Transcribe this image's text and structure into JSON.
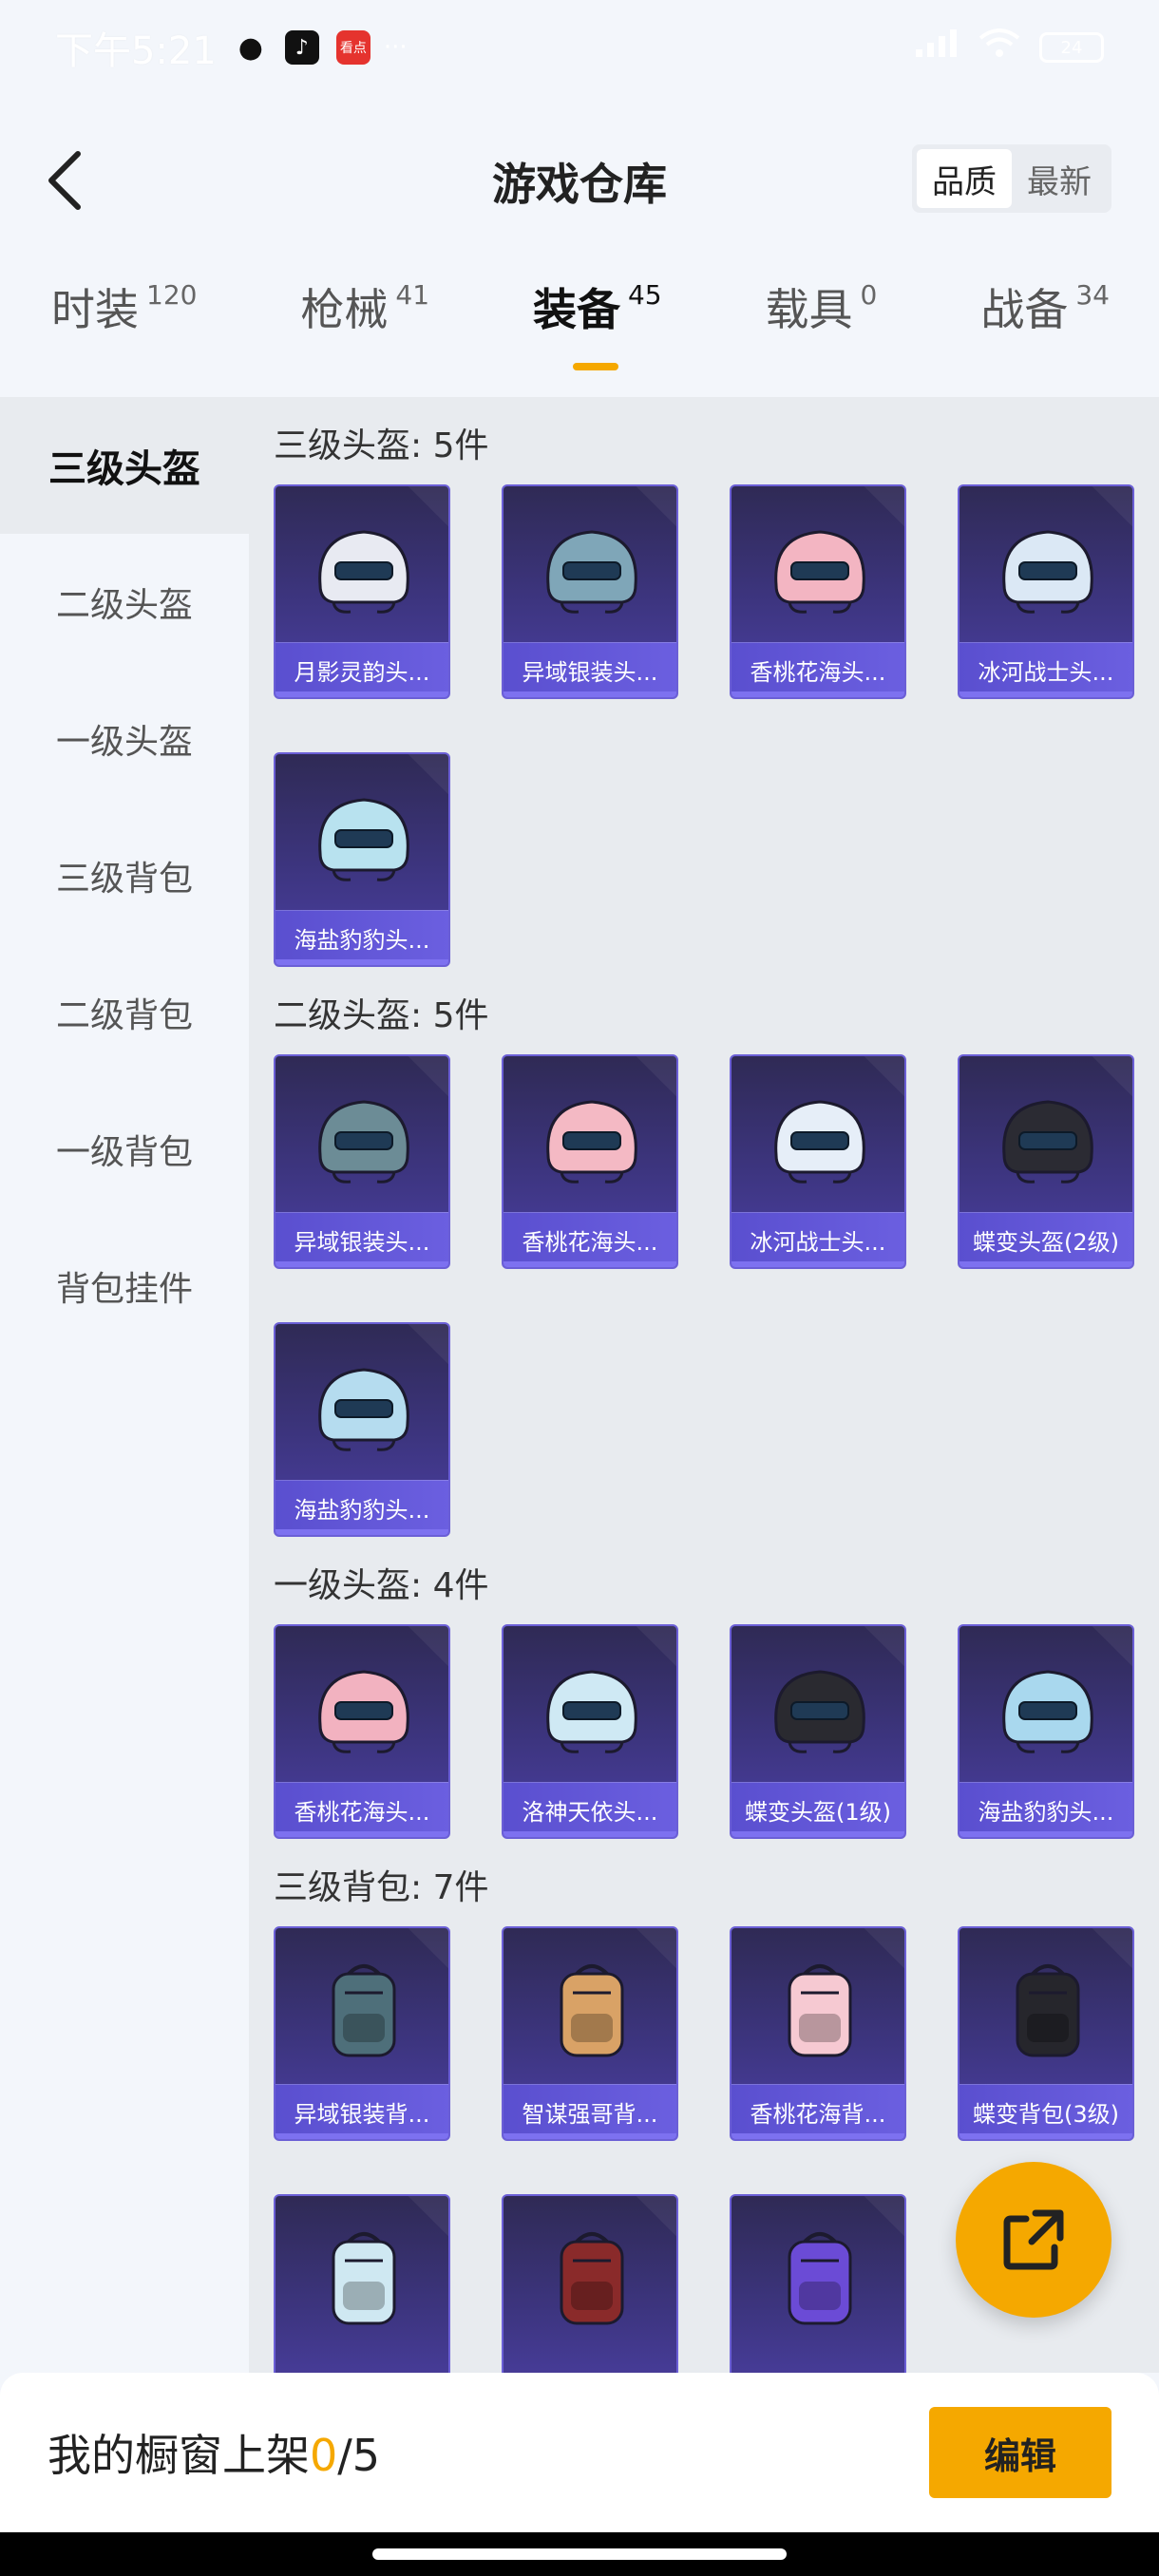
{
  "status_bar": {
    "time": "下午5:21",
    "apps": [
      "qq-icon",
      "tiktok-icon",
      "kandian-icon"
    ],
    "kandian_label": "看点",
    "dots": "···",
    "battery": "24"
  },
  "header": {
    "title": "游戏仓库",
    "sort_options": [
      "品质",
      "最新"
    ],
    "active_sort": "品质"
  },
  "tabs": [
    {
      "label": "时装",
      "count": "120"
    },
    {
      "label": "枪械",
      "count": "41"
    },
    {
      "label": "装备",
      "count": "45"
    },
    {
      "label": "载具",
      "count": "0"
    },
    {
      "label": "战备",
      "count": "34"
    }
  ],
  "active_tab": "装备",
  "sidebar": [
    {
      "label": "三级头盔"
    },
    {
      "label": "二级头盔"
    },
    {
      "label": "一级头盔"
    },
    {
      "label": "三级背包"
    },
    {
      "label": "二级背包"
    },
    {
      "label": "一级背包"
    },
    {
      "label": "背包挂件"
    }
  ],
  "active_sidebar": "三级头盔",
  "sections": [
    {
      "title": "三级头盔: 5件",
      "items": [
        {
          "name": "月影灵韵头...",
          "icon": "helmet-icon",
          "color": "#e8eaf2"
        },
        {
          "name": "异域银装头...",
          "icon": "helmet-icon",
          "color": "#7fa6b8"
        },
        {
          "name": "香桃花海头...",
          "icon": "helmet-icon",
          "color": "#f3b5c2"
        },
        {
          "name": "冰河战士头...",
          "icon": "helmet-icon",
          "color": "#dbe8f5"
        },
        {
          "name": "海盐豹豹头...",
          "icon": "helmet-icon",
          "color": "#b8e2ef"
        }
      ]
    },
    {
      "title": "二级头盔: 5件",
      "items": [
        {
          "name": "异域银装头...",
          "icon": "helmet-icon",
          "color": "#6c8c96"
        },
        {
          "name": "香桃花海头...",
          "icon": "helmet-icon",
          "color": "#f4b9c4"
        },
        {
          "name": "冰河战士头...",
          "icon": "helmet-icon",
          "color": "#e6eef8"
        },
        {
          "name": "蝶变头盔(2级)",
          "icon": "helmet-icon",
          "color": "#2b2b33"
        },
        {
          "name": "海盐豹豹头...",
          "icon": "helmet-icon",
          "color": "#b5dcef"
        }
      ]
    },
    {
      "title": "一级头盔: 4件",
      "items": [
        {
          "name": "香桃花海头...",
          "icon": "helmet-icon",
          "color": "#f2b2c0"
        },
        {
          "name": "洛神天依头...",
          "icon": "helmet-icon",
          "color": "#cfe9f4"
        },
        {
          "name": "蝶变头盔(1级)",
          "icon": "helmet-icon",
          "color": "#2a2a30"
        },
        {
          "name": "海盐豹豹头...",
          "icon": "helmet-icon",
          "color": "#a9d8ee"
        }
      ]
    },
    {
      "title": "三级背包: 7件",
      "items": [
        {
          "name": "异域银装背...",
          "icon": "backpack-icon",
          "color": "#4e6f7a"
        },
        {
          "name": "智谋强哥背...",
          "icon": "backpack-icon",
          "color": "#d9a266"
        },
        {
          "name": "香桃花海背...",
          "icon": "backpack-icon",
          "color": "#f6c9d2"
        },
        {
          "name": "蝶变背包(3级)",
          "icon": "backpack-icon",
          "color": "#26262c"
        },
        {
          "name": "",
          "icon": "backpack-icon",
          "color": "#cfe8f2"
        },
        {
          "name": "",
          "icon": "backpack-icon",
          "color": "#8a2a2a"
        },
        {
          "name": "",
          "icon": "backpack-icon",
          "color": "#6b4bd6"
        }
      ]
    }
  ],
  "bottom_bar": {
    "label": "我的橱窗上架",
    "current": "0",
    "total": "/5",
    "edit_label": "编辑"
  },
  "accent_color": "#f5a800"
}
